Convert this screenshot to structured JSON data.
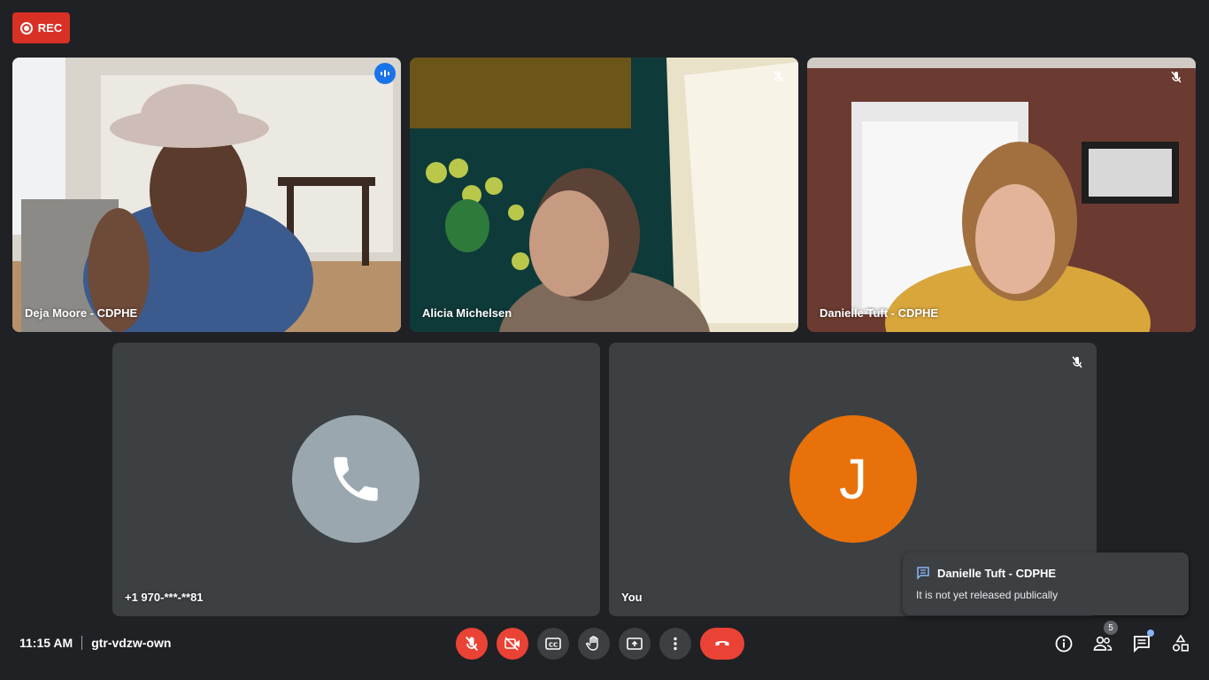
{
  "recording": {
    "label": "REC"
  },
  "participants": [
    {
      "name": "Deja Moore - CDPHE",
      "state": "speaking"
    },
    {
      "name": "Alicia Michelsen",
      "state": "muted"
    },
    {
      "name": "Danielle Tuft - CDPHE",
      "state": "muted"
    },
    {
      "name": "+1 970-***-**81",
      "state": "phone"
    },
    {
      "name": "You",
      "initial": "J",
      "avatar_color": "#e8710a",
      "state": "muted"
    }
  ],
  "footer": {
    "time": "11:15 AM",
    "meeting_code": "gtr-vdzw-own",
    "people_count": "5"
  },
  "chat_toast": {
    "sender": "Danielle Tuft - CDPHE",
    "message": "It is not yet released publically"
  },
  "colors": {
    "accent": "#8ab4f8",
    "danger": "#ea4335",
    "background": "#202124",
    "tile": "#3c4043"
  }
}
